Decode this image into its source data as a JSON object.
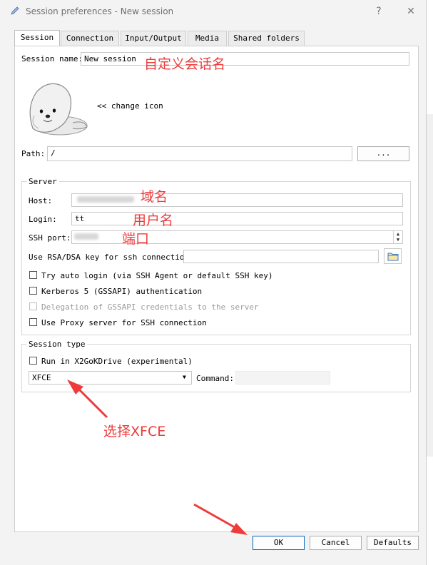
{
  "window": {
    "title": "Session preferences - New session",
    "help_glyph": "?",
    "close_glyph": "✕"
  },
  "tabs": [
    {
      "label": "Session"
    },
    {
      "label": "Connection"
    },
    {
      "label": "Input/Output"
    },
    {
      "label": "Media"
    },
    {
      "label": "Shared folders"
    }
  ],
  "session": {
    "name_label": "Session name:",
    "name_value": "New session",
    "change_icon_label": "<< change icon",
    "path_label": "Path:",
    "path_value": "/",
    "browse_label": "..."
  },
  "server": {
    "group_label": "Server",
    "host_label": "Host:",
    "login_label": "Login:",
    "login_value": "tt",
    "ssh_port_label": "SSH port:",
    "rsa_label": "Use RSA/DSA key for ssh connection:",
    "options": [
      {
        "label": "Try auto login (via SSH Agent or default SSH key)",
        "checked": false,
        "disabled": false
      },
      {
        "label": "Kerberos 5 (GSSAPI) authentication",
        "checked": false,
        "disabled": false
      },
      {
        "label": "Delegation of GSSAPI credentials to the server",
        "checked": false,
        "disabled": true
      },
      {
        "label": "Use Proxy server for SSH connection",
        "checked": false,
        "disabled": false
      }
    ]
  },
  "session_type": {
    "group_label": "Session type",
    "x2go_label": "Run in X2GoKDrive (experimental)",
    "desktop_value": "XFCE",
    "command_label": "Command:"
  },
  "buttons": {
    "ok": "OK",
    "cancel": "Cancel",
    "defaults": "Defaults"
  },
  "annotations": {
    "session_name": "自定义会话名",
    "host": "域名",
    "login": "用户名",
    "port": "端口",
    "xfce": "选择XFCE"
  },
  "colors": {
    "annotation": "#ee3b3b",
    "default_button_border": "#0067c0"
  }
}
